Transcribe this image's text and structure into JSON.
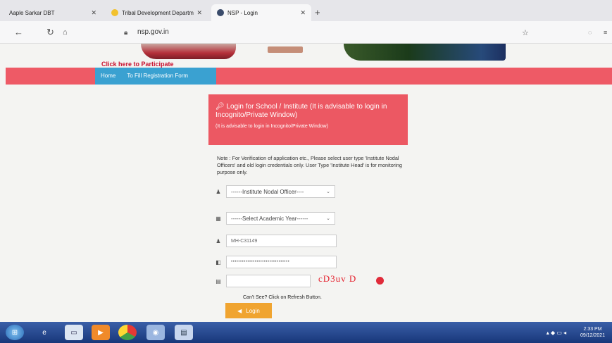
{
  "browser": {
    "tabs": [
      {
        "label": "Aaple Sarkar DBT"
      },
      {
        "label": "Tribal Development Departm"
      },
      {
        "label": "NSP - Login"
      }
    ],
    "url": "nsp.gov.in"
  },
  "header": {
    "participate": "Click here to Participate"
  },
  "menu": {
    "items": [
      "Home",
      "To Fill Registration Form"
    ]
  },
  "login": {
    "title": "Login for School / Institute (It is advisable to login in Incognito/Private Window)",
    "subtitle": "(It is advisable to login in Incognito/Private Window)",
    "note": "Note : For Verification of application etc., Please select user type 'Institute Nodal Officers' and old login credentials only. User Type 'Institute Head' is for monitoring purpose only.",
    "user_type": "------Institute Nodal Officer----",
    "academic_year": "------Select Academic Year------",
    "username": "MH-C31149",
    "password": "••••••••••••••••••••••••••••••••",
    "captcha_text": "cD3uv D",
    "cant_see": "Can't See? Click on Refresh Button.",
    "login_button": "Login"
  },
  "taskbar": {
    "time": "2:33 PM",
    "date": "09/12/2021"
  }
}
